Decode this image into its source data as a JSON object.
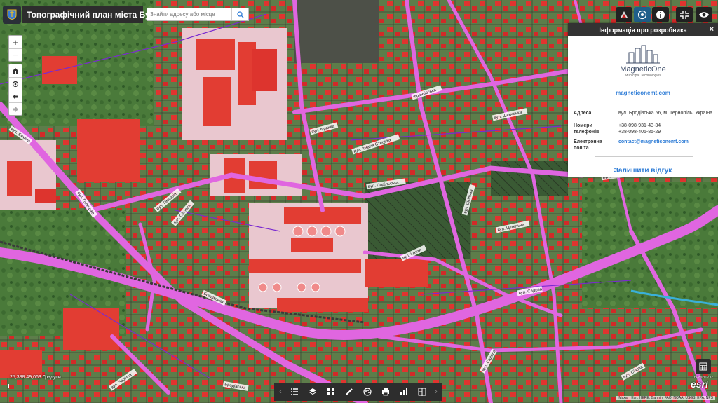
{
  "header": {
    "app_title": "Топографічний план міста Бучач",
    "search_placeholder": "Знайти адресу або місце"
  },
  "icons": {
    "logo": "coat-of-arms-icon",
    "search": "search-icon",
    "layers_tool": "palette-icon",
    "basemap_tool": "globe-icon",
    "info_tool": "info-icon",
    "fullscreen_tool": "fullscreen-icon",
    "visibility_tool": "eye-icon"
  },
  "colors": {
    "accent": "#2c7bd6",
    "panel_header": "#333333",
    "buildings": "#e8322f",
    "roads": "#e060e0",
    "parcels": "#7a2ad0"
  },
  "zoom": {
    "in_label": "+",
    "out_label": "−"
  },
  "info_panel": {
    "title": "Інформація про розробника",
    "close_label": "×",
    "company_name": "MagneticOne",
    "company_subtitle": "Municipal Technologies",
    "website": "magneticonemt.com",
    "address_label": "Адреса",
    "address_value": "вул. Бродівська 56, м. Тернопіль, Україна",
    "phones_label": "Номери телефонів",
    "phone_1": "+38-098-931-43-34",
    "phone_2": "+38-098-405-85-29",
    "email_label": "Електронна пошта",
    "email_value": "contact@magneticonemt.com",
    "feedback_label": "Залишити відгук"
  },
  "status": {
    "coordinates": "25,388 49,063 Градуси",
    "attribution": "Maxar | Esri, HERE, Garmin, FAO, NOAA, USGS, EPA, NPS"
  },
  "branding": {
    "esri": "esri",
    "powered_by": "POWERED BY"
  },
  "streets": [
    "вул. Бучача",
    "вул. Галицька",
    "вул. Гімназія",
    "вул. Січових",
    "вул. Франка",
    "вул. Ігнатія Стецика",
    "вул. Подільська",
    "вул. Шевченка",
    "вул. Садова",
    "вул. Цегельна",
    "Франківська",
    "вул. Шкільна",
    "вул. Тернопільська",
    "Бродівська",
    "вул. Князя",
    "вул. Садова",
    "вул. Січова",
    "Бродівська",
    "вул. Зарічна"
  ]
}
